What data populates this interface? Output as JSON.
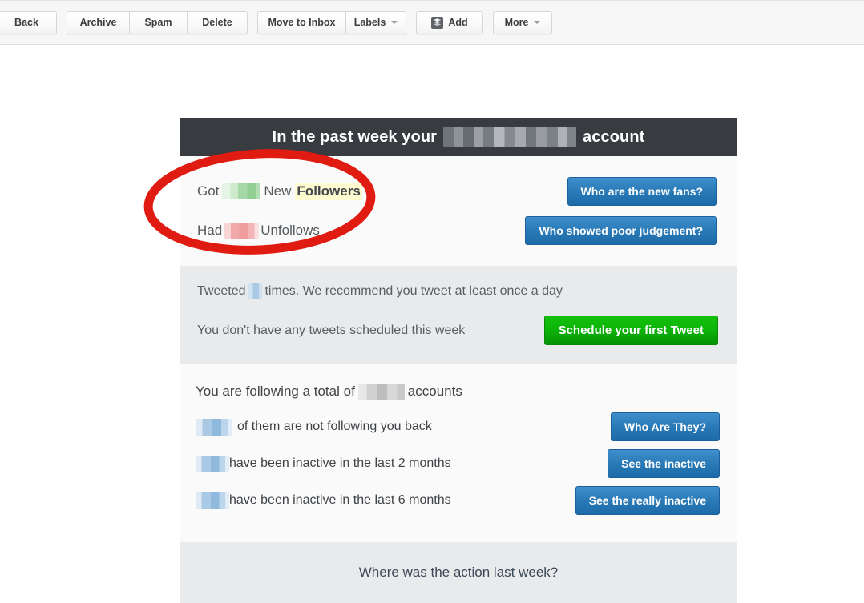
{
  "toolbar": {
    "buttons": [
      {
        "label": "Back",
        "icon": null,
        "caret": false
      },
      {
        "label": "Archive",
        "icon": null,
        "caret": false
      },
      {
        "label": "Spam",
        "icon": null,
        "caret": false
      },
      {
        "label": "Delete",
        "icon": null,
        "caret": false
      },
      {
        "label": "Move to Inbox",
        "icon": null,
        "caret": false
      },
      {
        "label": "Labels",
        "icon": null,
        "caret": true
      },
      {
        "label": "Add",
        "icon": "stack-icon",
        "caret": false
      },
      {
        "label": "More",
        "icon": null,
        "caret": true
      }
    ]
  },
  "email": {
    "header": {
      "prefix": "In the past week your",
      "redacted_account": "",
      "suffix": "account"
    },
    "followers_section": {
      "rows": [
        {
          "text_before": "Got",
          "redacted_value": "",
          "text_middle": "New",
          "highlighted_word": "Followers",
          "button_label": "Who are the new fans?"
        },
        {
          "text_before": "Had",
          "redacted_value": "",
          "text_middle": "Unfollows",
          "highlighted_word": "",
          "button_label": "Who showed poor judgement?"
        }
      ]
    },
    "tweets_section": {
      "line1_before": "Tweeted",
      "line1_redacted": "",
      "line1_after": "times. We recommend you tweet at least once a day",
      "line2_text": "You don't have any tweets scheduled this week",
      "line2_button": "Schedule your first Tweet"
    },
    "following_section": {
      "title_before": "You are following a total of",
      "title_redacted": "",
      "title_after": "accounts",
      "rows": [
        {
          "redacted_value": "",
          "text": "of them are not following you back",
          "button_label": "Who Are They?"
        },
        {
          "redacted_value": "",
          "text": "have been inactive in the last 2 months",
          "button_label": "See the inactive"
        },
        {
          "redacted_value": "",
          "text": "have been inactive in the last 6 months",
          "button_label": "See the really inactive"
        }
      ]
    },
    "footer": {
      "link_label": "Where was the action last week?"
    }
  },
  "annotation": {
    "shape": "red-ellipse",
    "color": "#e01b12"
  },
  "colors": {
    "header_bg": "#383b40",
    "body_bg": "#fafafa",
    "band_bg": "#e9eaeb",
    "button_blue": "#2a7ab8",
    "button_green": "#0db50a",
    "highlight_yellow": "#fdfbcf",
    "annotation_red": "#e01b12",
    "footer_link": "#3c4858"
  }
}
